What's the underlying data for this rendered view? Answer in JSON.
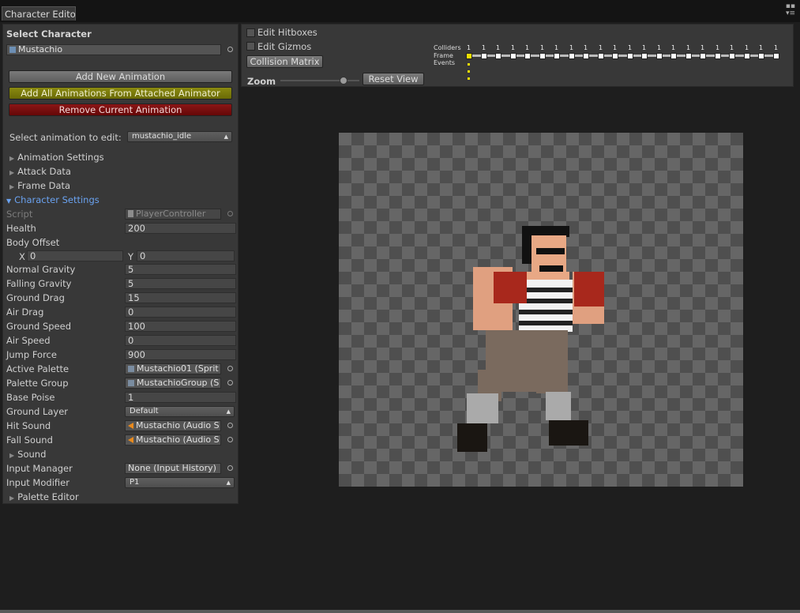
{
  "window": {
    "tab_title": "Character Edito",
    "menu_glyph": "▪▪\n▾≡"
  },
  "left": {
    "select_character_header": "Select Character",
    "character_field": "Mustachio",
    "buttons": {
      "add_new": "Add New Animation",
      "add_all": "Add All Animations From Attached Animator",
      "remove": "Remove Current Animation"
    },
    "select_anim_label": "Select animation to edit:",
    "select_anim_value": "mustachio_idle",
    "foldouts": {
      "animation_settings": "Animation Settings",
      "attack_data": "Attack Data",
      "frame_data": "Frame Data",
      "character_settings": "Character Settings",
      "sound": "Sound",
      "palette_editor": "Palette Editor"
    },
    "script_label": "Script",
    "script_value": "PlayerController",
    "health_label": "Health",
    "health_value": "200",
    "body_offset_label": "Body Offset",
    "x_label": "X",
    "x_value": "0",
    "y_label": "Y",
    "y_value": "0",
    "normal_gravity_label": "Normal Gravity",
    "normal_gravity_value": "5",
    "falling_gravity_label": "Falling Gravity",
    "falling_gravity_value": "5",
    "ground_drag_label": "Ground Drag",
    "ground_drag_value": "15",
    "air_drag_label": "Air Drag",
    "air_drag_value": "0",
    "ground_speed_label": "Ground Speed",
    "ground_speed_value": "100",
    "air_speed_label": "Air Speed",
    "air_speed_value": "0",
    "jump_force_label": "Jump Force",
    "jump_force_value": "900",
    "active_palette_label": "Active Palette",
    "active_palette_value": "Mustachio01 (Sprit",
    "palette_group_label": "Palette Group",
    "palette_group_value": "MustachioGroup (S",
    "base_poise_label": "Base Poise",
    "base_poise_value": "1",
    "ground_layer_label": "Ground Layer",
    "ground_layer_value": "Default",
    "hit_sound_label": "Hit Sound",
    "hit_sound_value": "Mustachio (Audio S",
    "fall_sound_label": "Fall Sound",
    "fall_sound_value": "Mustachio (Audio S",
    "input_manager_label": "Input Manager",
    "input_manager_value": "None (Input History)",
    "input_modifier_label": "Input Modifier",
    "input_modifier_value": "P1"
  },
  "right": {
    "edit_hitboxes": "Edit Hitboxes",
    "edit_gizmos": "Edit Gizmos",
    "collision_matrix": "Collision Matrix",
    "zoom_label": "Zoom",
    "zoom_level": 0.8,
    "reset_view": "Reset View",
    "timeline": {
      "colliders_label": "Colliders",
      "frame_label": "Frame",
      "events_label": "Events",
      "collider_counts": [
        "1",
        "1",
        "1",
        "1",
        "1",
        "1",
        "1",
        "1",
        "1",
        "1",
        "1",
        "1",
        "1",
        "1",
        "1",
        "1",
        "1",
        "1",
        "1",
        "1",
        "1",
        "1"
      ],
      "selected_frame": 0
    }
  },
  "colors": {
    "add_all_button": "#7a7a0a",
    "remove_button": "#7a1010",
    "foldout_open": "#6aa2f0",
    "selected_frame": "#f0e000"
  }
}
